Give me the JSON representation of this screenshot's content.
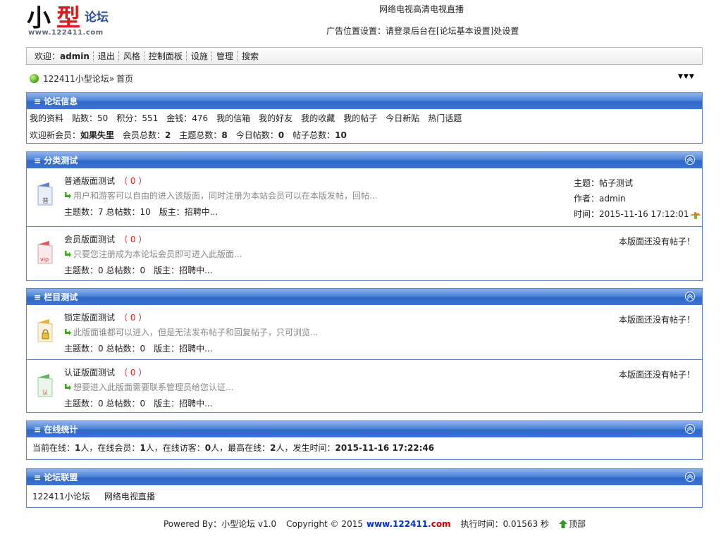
{
  "header": {
    "logo_text_a": "小",
    "logo_text_b": "型",
    "logo_text_c": "论坛",
    "logo_url": "www.122411.com",
    "ad_top": "网络电视高清电视直播",
    "ad_bottom": "广告位置设置：请登录后台在[论坛基本设置]处设置"
  },
  "nav": {
    "welcome": "欢迎：",
    "user": "admin",
    "items": [
      "退出",
      "风格",
      "控制面板",
      "设施",
      "管理",
      "搜索"
    ]
  },
  "breadcrumb": {
    "site": "122411小型论坛",
    "sep": "»",
    "page": "首页"
  },
  "forum_info": {
    "title": "≡ 论坛信息",
    "row1": {
      "profile": "我的资料",
      "posts_label": "贴数：",
      "posts": "50",
      "points_label": "积分：",
      "points": "551",
      "money_label": "金钱：",
      "money": "476",
      "links": [
        "我的信箱",
        "我的好友",
        "我的收藏",
        "我的帖子",
        "今日新贴",
        "热门话题"
      ]
    },
    "row2": {
      "new_member_label": "欢迎新会员：",
      "new_member": "如果失里",
      "members_label": "会员总数：",
      "members": "2",
      "topics_label": "主题总数：",
      "topics": "8",
      "today_label": "今日帖数：",
      "today": "0",
      "total_label": "帖子总数：",
      "total": "10"
    }
  },
  "categories": [
    {
      "title": "≡ 分类测试",
      "forums": [
        {
          "name": "普通版面测试",
          "count": "（ 0 ）",
          "desc": "用户和游客可以自由的进入该版面，同时注册为本站会员可以在本版发帖，回帖...",
          "stats": "主题数：7 总帖数：10　版主：招聘中...",
          "icon_text": "普",
          "icon_color": "#5b7fd6",
          "last_topic": "主题：帖子测试",
          "last_author": "作者：admin",
          "last_time": "时间：2015-11-16 17:12:01"
        },
        {
          "name": "会员版面测试",
          "count": "（ 0 ）",
          "desc": "只要您注册成为本论坛会员即可进入此版面...",
          "stats": "主题数：0 总帖数：0　版主：招聘中...",
          "icon_text": "vip",
          "icon_color": "#d94646",
          "no_post": "本版面还没有帖子！"
        }
      ]
    },
    {
      "title": "≡ 栏目测试",
      "forums": [
        {
          "name": "锁定版面测试",
          "count": "（ 0 ）",
          "desc": "此版面谁都可以进入，但是无法发布帖子和回复帖子，只可浏览...",
          "stats": "主题数：0 总帖数：0　版主：招聘中...",
          "icon_text": "",
          "icon_color": "#e0a92c",
          "no_post": "本版面还没有帖子！"
        },
        {
          "name": "认证版面测试",
          "count": "（ 0 ）",
          "desc": "想要进入此版面需要联系管理员给您认证...",
          "stats": "主题数：0 总帖数：0　版主：招聘中...",
          "icon_text": "认",
          "icon_color": "#49a84a",
          "no_post": "本版面还没有帖子！"
        }
      ]
    }
  ],
  "online": {
    "title": "≡ 在线统计",
    "t1": "当前在线：",
    "v1": "1",
    "t2": " 人，在线会员：",
    "v2": "1",
    "t3": " 人，在线访客：",
    "v3": "0",
    "t4": " 人，最高在线：",
    "v4": "2",
    "t5": " 人，发生时间：",
    "v5": "2015-11-16 17:22:46"
  },
  "league": {
    "title": "≡ 论坛联盟",
    "links": [
      "122411小论坛",
      "网络电视直播"
    ]
  },
  "footer": {
    "powered": "Powered By：小型论坛 v1.0",
    "copyright": "Copyright © 2015",
    "site_a": "www.122411.",
    "site_b": "com",
    "exec": "执行时间：0.01563 秒",
    "top": "顶部"
  }
}
